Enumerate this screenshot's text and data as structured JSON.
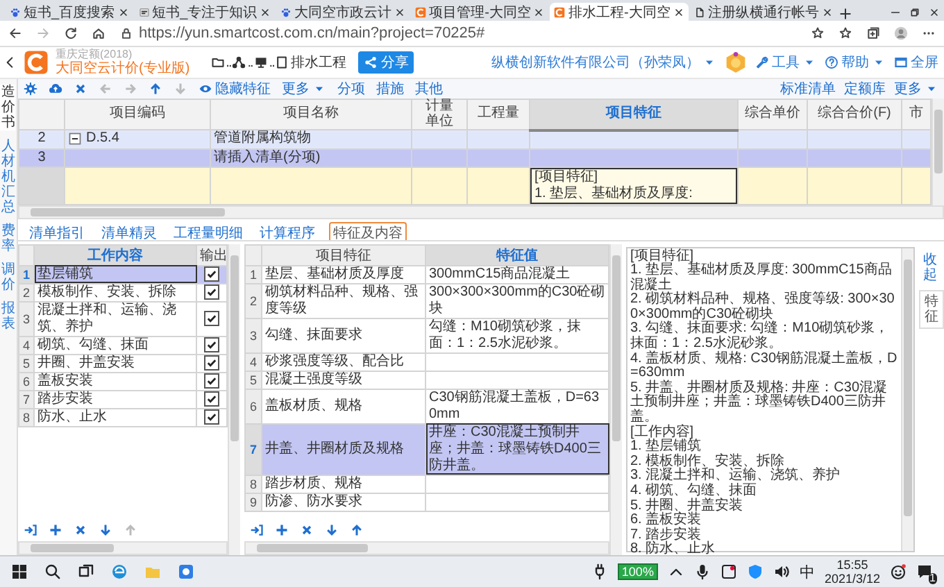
{
  "browser": {
    "tabs": [
      {
        "title": "短书_百度搜索",
        "kind": "search",
        "selected": false
      },
      {
        "title": "短书_专注于知识",
        "kind": "article",
        "selected": false
      },
      {
        "title": "大同空市政云计",
        "kind": "search",
        "selected": false
      },
      {
        "title": "项目管理-大同空",
        "kind": "app",
        "selected": false
      },
      {
        "title": "排水工程-大同空",
        "kind": "app",
        "selected": true
      },
      {
        "title": "注册纵横通行帐号",
        "kind": "page",
        "selected": false
      }
    ],
    "url": "https://yun.smartcost.com.cn/main?project=70225#"
  },
  "header": {
    "region": "重庆定额(2018)",
    "product": "大同空云计价(专业版)",
    "separator": "..",
    "project": "排水工程",
    "share": "分享",
    "account": "纵横创新软件有限公司（孙荣凤）",
    "menus": [
      {
        "label": "工具",
        "kind": "tools"
      },
      {
        "label": "帮助",
        "kind": "help"
      },
      {
        "label": "全屏",
        "kind": "fullscreen"
      }
    ]
  },
  "sidebar": [
    {
      "label": "造价书",
      "selected": true
    },
    {
      "label": "人材机汇总",
      "selected": false
    },
    {
      "label": "费率",
      "selected": false
    },
    {
      "label": "调价",
      "selected": false
    },
    {
      "label": "报表",
      "selected": false
    }
  ],
  "toolbar": {
    "icon_buttons": [
      {
        "kind": "settings",
        "disabled": false
      },
      {
        "kind": "upload",
        "disabled": false
      },
      {
        "kind": "delete",
        "disabled": false
      },
      {
        "kind": "left",
        "disabled": true
      },
      {
        "kind": "right",
        "disabled": true
      },
      {
        "kind": "up",
        "disabled": false
      },
      {
        "kind": "down",
        "disabled": true
      }
    ],
    "buttons": [
      {
        "label": "隐藏特征",
        "kind": "toggle"
      },
      {
        "label": "更多",
        "kind": "dropdown"
      },
      {
        "label": "分项",
        "kind": "plain"
      },
      {
        "label": "措施",
        "kind": "plain"
      },
      {
        "label": "其他",
        "kind": "plain"
      }
    ],
    "right_buttons": [
      {
        "label": "标准清单",
        "kind": "plain"
      },
      {
        "label": "定额库",
        "kind": "plain"
      },
      {
        "label": "更多",
        "kind": "dropdown"
      }
    ]
  },
  "grid": {
    "columns": [
      {
        "label": "项目编码",
        "selected": false
      },
      {
        "label": "项目名称",
        "selected": false
      },
      {
        "label": "计量单位",
        "selected": false
      },
      {
        "label": "工程量",
        "selected": false
      },
      {
        "label": "项目特征",
        "selected": true
      },
      {
        "label": "综合单价",
        "selected": false
      },
      {
        "label": "综合合价(F)",
        "selected": false
      },
      {
        "label": "市",
        "selected": false
      }
    ],
    "rows": [
      {
        "number": "2",
        "code": "D.5.4",
        "name": "管道附属构筑物",
        "kind": "section",
        "expanded": true,
        "selected": false
      },
      {
        "number": "3",
        "name": "请插入清单(分项)",
        "kind": "item",
        "selected": true
      },
      {
        "kind": "detail",
        "popup": [
          "[项目特征]",
          "1. 垫层、基础材质及厚度:"
        ],
        "selected": false
      }
    ]
  },
  "bottom_tabs": [
    {
      "label": "清单指引",
      "selected": false
    },
    {
      "label": "清单精灵",
      "selected": false
    },
    {
      "label": "工程量明细",
      "selected": false
    },
    {
      "label": "计算程序",
      "selected": false
    },
    {
      "label": "特征及内容",
      "selected": true
    }
  ],
  "work_content": {
    "columns": [
      {
        "label": "工作内容",
        "selected": true
      },
      {
        "label": "输出",
        "selected": false
      }
    ],
    "rows": [
      {
        "number": "1",
        "text": "垫层铺筑",
        "checked": true,
        "selected": true
      },
      {
        "number": "2",
        "text": "模板制作、安装、拆除",
        "checked": true,
        "selected": false
      },
      {
        "number": "3",
        "text": "混凝土拌和、运输、浇筑、养护",
        "checked": true,
        "selected": false
      },
      {
        "number": "4",
        "text": "砌筑、勾缝、抹面",
        "checked": true,
        "selected": false
      },
      {
        "number": "5",
        "text": "井圈、井盖安装",
        "checked": true,
        "selected": false
      },
      {
        "number": "6",
        "text": "盖板安装",
        "checked": true,
        "selected": false
      },
      {
        "number": "7",
        "text": "踏步安装",
        "checked": true,
        "selected": false
      },
      {
        "number": "8",
        "text": "防水、止水",
        "checked": true,
        "selected": false
      }
    ],
    "tools": [
      {
        "kind": "insert",
        "disabled": false
      },
      {
        "kind": "add",
        "disabled": false
      },
      {
        "kind": "delete",
        "disabled": false
      },
      {
        "kind": "down",
        "disabled": false
      },
      {
        "kind": "up",
        "disabled": true
      }
    ]
  },
  "features": {
    "columns": [
      {
        "label": "项目特征",
        "selected": false
      },
      {
        "label": "特征值",
        "selected": true
      }
    ],
    "rows": [
      {
        "number": "1",
        "name": "垫层、基础材质及厚度",
        "value": "300mmC15商品混凝土",
        "selected": false
      },
      {
        "number": "2",
        "name": "砌筑材料品种、规格、强度等级",
        "value": "300×300×300mm的C30砼砌块",
        "selected": false
      },
      {
        "number": "3",
        "name": "勾缝、抹面要求",
        "value": "勾缝：M10砌筑砂浆，抹面：1：2.5水泥砂浆。",
        "selected": false
      },
      {
        "number": "4",
        "name": "砂浆强度等级、配合比",
        "selected": false
      },
      {
        "number": "5",
        "name": "混凝土强度等级",
        "selected": false
      },
      {
        "number": "6",
        "name": "盖板材质、规格",
        "value": "C30钢筋混凝土盖板，D=630mm",
        "selected": false
      },
      {
        "number": "7",
        "name": "井盖、井圈材质及规格",
        "value": "井座：C30混凝土预制井座；井盖：球墨铸铁D400三防井盖。",
        "selected": true
      },
      {
        "number": "8",
        "name": "踏步材质、规格",
        "selected": false
      },
      {
        "number": "9",
        "name": "防渗、防水要求",
        "selected": false
      }
    ],
    "tools": [
      {
        "kind": "insert",
        "disabled": false
      },
      {
        "kind": "add",
        "disabled": false
      },
      {
        "kind": "delete",
        "disabled": false
      },
      {
        "kind": "down",
        "disabled": false
      },
      {
        "kind": "up",
        "disabled": false
      }
    ]
  },
  "description": [
    "[项目特征]",
    "1. 垫层、基础材质及厚度: 300mmC15商品混凝土",
    "2. 砌筑材料品种、规格、强度等级: 300×300×300mm的C30砼砌块",
    "3. 勾缝、抹面要求: 勾缝：M10砌筑砂浆，抹面：1：2.5水泥砂浆。",
    "4. 盖板材质、规格: C30钢筋混凝土盖板，D=630mm",
    "5. 井盖、井圈材质及规格: 井座：C30混凝土预制井座；井盖：球墨铸铁D400三防井盖。",
    "[工作内容]",
    "1. 垫层铺筑",
    "2. 模板制作、安装、拆除",
    "3. 混凝土拌和、运输、浇筑、养护",
    "4. 砌筑、勾缝、抹面",
    "5. 井圈、井盖安装",
    "6. 盖板安装",
    "7. 踏步安装",
    "8. 防水、止水"
  ],
  "side_tabs": [
    {
      "label": "收起",
      "kind": "link"
    },
    {
      "label": "特征",
      "kind": "tab"
    }
  ],
  "taskbar": {
    "battery": "100%",
    "ime": "中",
    "time": "15:55",
    "date": "2021/3/12",
    "notifications": "1"
  }
}
